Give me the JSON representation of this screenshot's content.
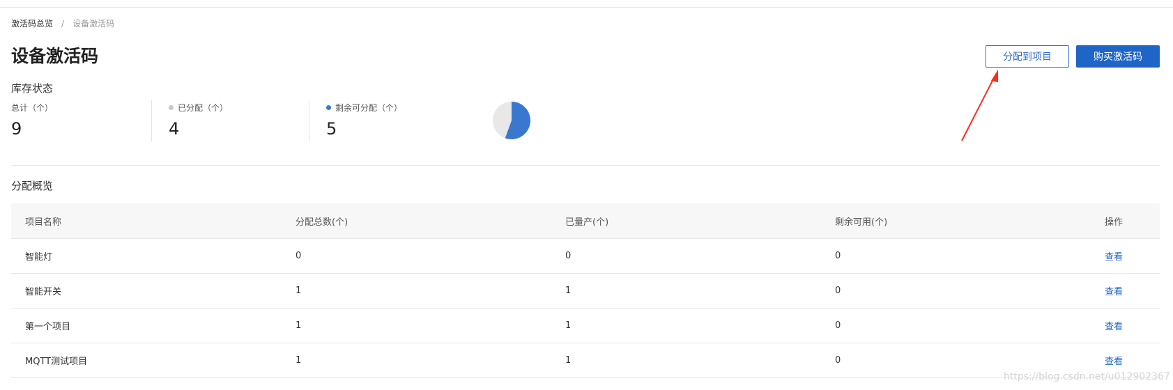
{
  "breadcrumb": {
    "parent": "激活码总览",
    "separator": "/",
    "current": "设备激活码"
  },
  "page_title": "设备激活码",
  "actions": {
    "assign_label": "分配到项目",
    "buy_label": "购买激活码"
  },
  "inventory": {
    "title": "库存状态",
    "stats": [
      {
        "label": "总计（个）",
        "value": "9"
      },
      {
        "label": "已分配（个）",
        "value": "4",
        "dot_color": "#c8c8c8"
      },
      {
        "label": "剩余可分配（个）",
        "value": "5",
        "dot_color": "#3a78cf"
      }
    ],
    "pie": {
      "allocated": 4,
      "remaining": 5,
      "allocated_color": "#e8e8e8",
      "remaining_color": "#3a78cf"
    }
  },
  "allocation": {
    "title": "分配概览",
    "columns": [
      "项目名称",
      "分配总数(个)",
      "已量产(个)",
      "剩余可用(个)",
      "操作"
    ],
    "rows": [
      {
        "name": "智能灯",
        "total": "0",
        "produced": "0",
        "remaining": "0",
        "action": "查看"
      },
      {
        "name": "智能开关",
        "total": "1",
        "produced": "1",
        "remaining": "0",
        "action": "查看"
      },
      {
        "name": "第一个项目",
        "total": "1",
        "produced": "1",
        "remaining": "0",
        "action": "查看"
      },
      {
        "name": "MQTT测试项目",
        "total": "1",
        "produced": "1",
        "remaining": "0",
        "action": "查看"
      }
    ]
  },
  "annotation": {
    "arrow_color": "#ff2a1a"
  },
  "watermark": "https://blog.csdn.net/u012902367",
  "colors": {
    "primary": "#1f65c8",
    "accent": "#3a78cf"
  }
}
